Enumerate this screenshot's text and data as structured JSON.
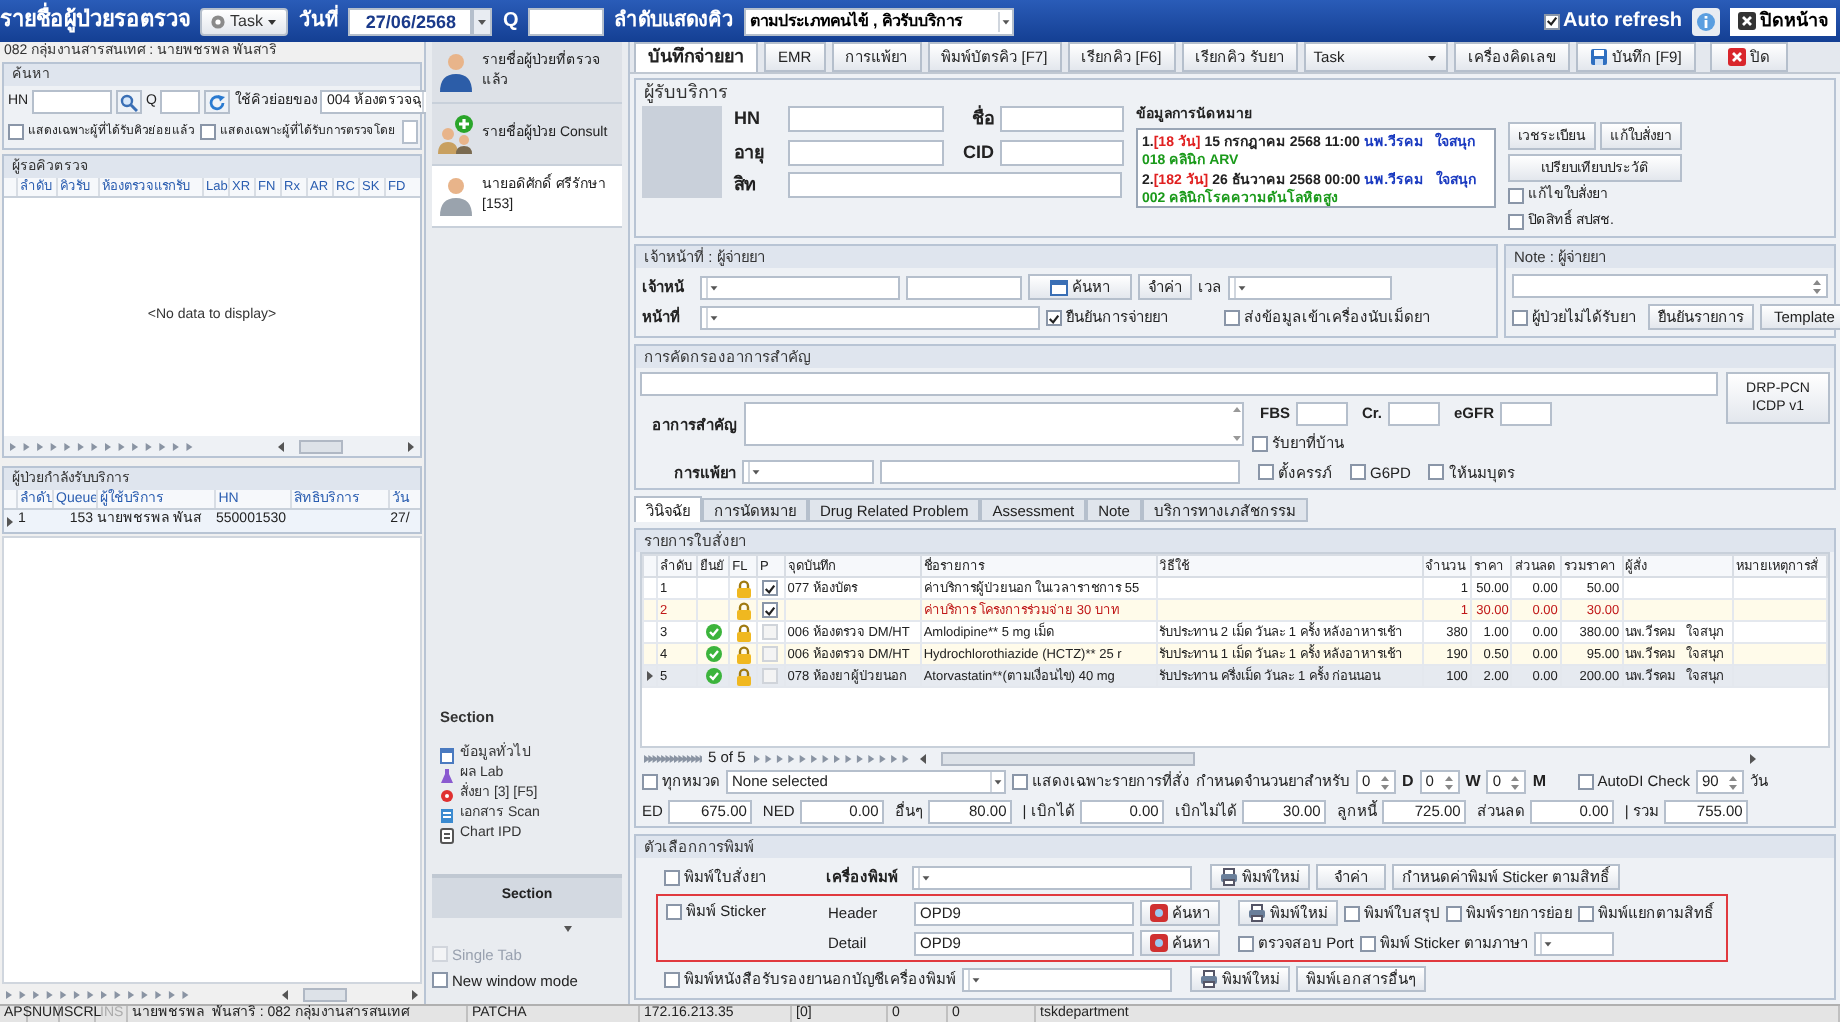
{
  "top_bar": {
    "title": "รายชื่อผู้ป่วยรอตรวจ",
    "task_button": "Task",
    "date_label": "วันที่",
    "date_value": "27/06/2568",
    "queue_label": "Q",
    "order_label": "ลำดับแสดงคิว",
    "order_value": "ตามประเภทคนไข้ , คิวรับบริการ",
    "auto_refresh": {
      "label": "Auto refresh",
      "checked": true
    },
    "close_button": "ปิดหน้าจ"
  },
  "left_panel": {
    "user_line": "082 กลุ่มงานสารสนเทศ : นายพชรพล  พันสาริ",
    "search": {
      "title": "ค้นหา",
      "hn_label": "HN",
      "q_label": "Q",
      "sub_queue_label": "ใช้คิวย่อยของ",
      "sub_queue_value": "004 ห้องตรวจฉุ",
      "options": [
        {
          "label": "แสดงเฉพาะผู้ที่ได้รับคิวย่อยแล้ว",
          "checked": false
        },
        {
          "label": "แสดงเฉพาะผู้ที่ได้รับการตรวจโดย",
          "checked": false
        }
      ]
    },
    "waiting": {
      "title": "ผู้รอคิวตรวจ",
      "columns": [
        "ลำดับ",
        "คิวรับ",
        "ห้องตรวจแรกรับ",
        "Lab",
        "XR",
        "FN",
        "Rx",
        "AR",
        "RC",
        "SK",
        "FD"
      ],
      "empty_text": "<No data to display>"
    },
    "in_service": {
      "title": "ผู้ป่วยกำลังรับบริการ",
      "columns": [
        "ลำดับ",
        "Queue",
        "ผู้ใช้บริการ",
        "HN",
        "สิทธิบริการ",
        "วัน"
      ],
      "rows": [
        {
          "selected": true,
          "order": "1",
          "queue": "153",
          "patient": "นายพชรพล  พันส",
          "hn": "550001530",
          "date": "27/"
        }
      ]
    }
  },
  "middle_panel": {
    "nav_items": [
      {
        "kind": "doctor",
        "label": "รายชื่อผู้ป่วยที่ตรวจแล้ว",
        "selected": false
      },
      {
        "kind": "consult",
        "label": "รายชื่อผู้ป่วย Consult",
        "selected": false
      },
      {
        "kind": "patient",
        "label": "นายอดิศักดิ์ ศรีรักษา [153]",
        "selected": true
      }
    ],
    "section_title": "Section",
    "section_items": [
      {
        "kind": "info",
        "label": "ข้อมูลทั่วไป"
      },
      {
        "kind": "lab",
        "label": "ผล Lab"
      },
      {
        "kind": "drug",
        "label": "สั่งยา [3] [F5]"
      },
      {
        "kind": "scan",
        "label": "เอกสาร Scan"
      },
      {
        "kind": "chart",
        "label": "Chart IPD"
      }
    ],
    "section_button": "Section",
    "window_options": [
      {
        "label": "Single Tab",
        "checked": false,
        "disabled": true
      },
      {
        "label": "New window mode",
        "checked": false,
        "disabled": false
      }
    ]
  },
  "toolbar": [
    {
      "kind": "tab",
      "label": "บันทึกจ่ายยา",
      "selected": true
    },
    {
      "kind": "tab",
      "label": "EMR",
      "selected": false
    },
    {
      "kind": "tab",
      "label": "การแพ้ยา",
      "selected": false
    },
    {
      "kind": "button",
      "label": "พิมพ์บัตรคิว [F7]",
      "selected": false
    },
    {
      "kind": "button",
      "label": "เรียกคิว [F6]",
      "selected": false
    },
    {
      "kind": "button",
      "label": "เรียกคิว รับยา",
      "selected": false
    },
    {
      "kind": "dropdown",
      "label": "Task",
      "selected": false
    },
    {
      "kind": "button",
      "label": "เครื่องคิดเลข",
      "selected": false
    },
    {
      "kind": "save",
      "label": "บันทึก [F9]",
      "selected": false
    },
    {
      "kind": "close",
      "label": "ปิด",
      "selected": false
    }
  ],
  "patient": {
    "title": "ผู้รับบริการ",
    "fields": [
      "HN",
      "ชื่อ",
      "อายุ",
      "CID",
      "สิท"
    ],
    "appointments": {
      "title": "ข้อมูลการนัดหมาย",
      "items": [
        {
          "number": "1.",
          "days": "[18 วัน]",
          "date": "15 กรกฎาคม 2568 11:00",
          "doctor": "นพ.วีรคม   ใจสนุก",
          "clinic": "018 คลินิก ARV"
        },
        {
          "number": "2.",
          "days": "[182 วัน]",
          "date": "26 ธันวาคม 2568 00:00",
          "doctor": "นพ.วีรคม   ใจสนุก",
          "clinic": "002 คลินิกโรคความดันโลหิตสูง"
        }
      ]
    },
    "buttons": [
      "เวชระเบียน",
      "แก้ใบสั่งยา",
      "เปรียบเทียบประวัติ"
    ],
    "options": [
      {
        "label": "แก้ไขใบสั่งยา",
        "checked": false
      },
      {
        "label": "ปิดสิทธิ์ สปสช.",
        "checked": false
      }
    ]
  },
  "dispenser": {
    "title": "เจ้าหน้าที่ : ผู้จ่ายยา",
    "officer_label": "เจ้าหน้",
    "search_button": "ค้นหา",
    "remember_button": "จำค่า",
    "time_label": "เวล",
    "role_label": "หน้าที่",
    "confirm": {
      "label": "ยืนยันการจ่ายยา",
      "checked": true
    },
    "send_counter": {
      "label": "ส่งข้อมูลเข้าเครื่องนับเม็ดยา",
      "checked": false
    }
  },
  "note": {
    "title": "Note : ผู้จ่ายยา",
    "no_drug": {
      "label": "ผู้ป่วยไม่ได้รับยา",
      "checked": false
    },
    "buttons": [
      "ยืนยันรายการ",
      "Template"
    ]
  },
  "screening": {
    "title": "การคัดกรองอาการสำคัญ",
    "symptom_label": "อาการสำคัญ",
    "allergy_label": "การแพ้ยา",
    "labs": [
      "FBS",
      "Cr.",
      "eGFR"
    ],
    "drp_button": [
      "DRP-PCN",
      "ICDP v1"
    ],
    "flags": [
      {
        "label": "รับยาที่บ้าน",
        "checked": false
      },
      {
        "label": "ตั้งครรภ์",
        "checked": false
      },
      {
        "label": "G6PD",
        "checked": false
      },
      {
        "label": "ให้นมบุตร",
        "checked": false
      }
    ]
  },
  "detail_tabs": [
    {
      "label": "วินิจฉัย",
      "selected": true
    },
    {
      "label": "การนัดหมาย",
      "selected": false
    },
    {
      "label": "Drug Related Problem",
      "selected": false
    },
    {
      "label": "Assessment",
      "selected": false
    },
    {
      "label": "Note",
      "selected": false
    },
    {
      "label": "บริการทางเภสัชกรรม",
      "selected": false
    }
  ],
  "orders": {
    "title": "รายการใบสั่งยา",
    "columns": [
      "ลำดับ",
      "ยืนยั",
      "FL",
      "P",
      "จุดบันทึก",
      "ชื่อรายการ",
      "วิธีใช้",
      "จำนวน",
      "ราคา",
      "ส่วนลด",
      "รวมราคา",
      "ผู้สั่ง",
      "หมายเหตุการสั่"
    ],
    "rows": [
      {
        "selected": false,
        "flagged": false,
        "no": "1",
        "confirmed": false,
        "locked": true,
        "printed": true,
        "station": "077 ห้องบัตร",
        "item": "ค่าบริการผู้ป่วยนอก ในเวลาราชการ 55",
        "quantity": "1",
        "price": "50.00",
        "discount": "0.00",
        "total": "50.00"
      },
      {
        "selected": false,
        "flagged": true,
        "no": "2",
        "confirmed": false,
        "locked": true,
        "printed": true,
        "item": "ค่าบริการ โครงการร่วมจ่าย 30 บาท",
        "quantity": "1",
        "price": "30.00",
        "discount": "0.00",
        "total": "30.00"
      },
      {
        "selected": false,
        "flagged": false,
        "no": "3",
        "confirmed": true,
        "locked": true,
        "printed": false,
        "station": "006 ห้องตรวจ DM/HT",
        "item": "Amlodipine** 5 mg เม็ด",
        "usage": "รับประทาน 2 เม็ด วันละ 1 ครั้ง หลังอาหารเช้า",
        "quantity": "380",
        "price": "1.00",
        "discount": "0.00",
        "total": "380.00",
        "prescriber": "นพ.วีรคม   ใจสนุก"
      },
      {
        "selected": false,
        "flagged": false,
        "no": "4",
        "confirmed": true,
        "locked": true,
        "printed": false,
        "station": "006 ห้องตรวจ DM/HT",
        "item": "Hydrochlorothiazide (HCTZ)** 25 r",
        "usage": "รับประทาน 1 เม็ด วันละ 1 ครั้ง หลังอาหารเช้า",
        "quantity": "190",
        "price": "0.50",
        "discount": "0.00",
        "total": "95.00",
        "prescriber": "นพ.วีรคม   ใจสนุก"
      },
      {
        "selected": true,
        "flagged": false,
        "no": "5",
        "confirmed": true,
        "locked": true,
        "printed": false,
        "station": "078 ห้องยาผู้ป่วยนอก",
        "item": "Atorvastatin**(ตามเงื่อนไข) 40 mg",
        "usage": "รับประทาน ครึ่งเม็ด วันละ 1 ครั้ง ก่อนนอน",
        "quantity": "100",
        "price": "2.00",
        "discount": "0.00",
        "total": "200.00",
        "prescriber": "นพ.วีรคม   ใจสนุก"
      }
    ],
    "pager": "5 of 5"
  },
  "filters": {
    "all_categories": {
      "label": "ทุกหมวด",
      "checked": false
    },
    "category_value": "None selected",
    "ordered_only": {
      "label": "แสดงเฉพาะรายการที่สั่ง",
      "checked": false
    },
    "supply_label": "กำหนดจำนวนยาสำหรับ",
    "units": [
      {
        "value": "0",
        "unit": "D"
      },
      {
        "value": "0",
        "unit": "W"
      },
      {
        "value": "0",
        "unit": "M"
      }
    ],
    "auto_di": {
      "label": "AutoDI Check",
      "checked": false
    },
    "days_value": "90",
    "days_label": "วัน"
  },
  "totals": [
    {
      "label": "ED",
      "value": "675.00"
    },
    {
      "label": "NED",
      "value": "0.00"
    },
    {
      "label": "อื่นๆ",
      "value": "80.00"
    },
    {
      "label": "| เบิกได้",
      "value": "0.00"
    },
    {
      "label": "เบิกไม่ได้",
      "value": "30.00"
    },
    {
      "label": "ลูกหนี้",
      "value": "725.00"
    },
    {
      "label": "ส่วนลด",
      "value": "0.00"
    },
    {
      "label": "| รวม",
      "value": "755.00"
    }
  ],
  "print_options": {
    "title": "ตัวเลือกการพิมพ์",
    "print_rx": {
      "label": "พิมพ์ใบสั่งยา",
      "checked": false
    },
    "printer_label": "เครื่องพิมพ์",
    "reprint_button": "พิมพ์ใหม่",
    "remember_button": "จำค่า",
    "sticker_rights_button": "กำหนดค่าพิมพ์ Sticker ตามสิทธิ์",
    "sticker": {
      "label": "พิมพ์ Sticker",
      "checked": false,
      "header_label": "Header",
      "header_value": "OPD9",
      "header_search_button": "ค้นหา",
      "reprint_button": "พิมพ์ใหม่",
      "options": [
        {
          "label": "พิมพ์ใบสรุป",
          "checked": false
        },
        {
          "label": "พิมพ์รายการย่อย",
          "checked": false
        },
        {
          "label": "พิมพ์แยกตามสิทธิ์",
          "checked": false
        }
      ],
      "detail_label": "Detail",
      "detail_value": "OPD9",
      "detail_search_button": "ค้นหา",
      "detail_options": [
        {
          "label": "ตรวจสอบ Port",
          "checked": false
        },
        {
          "label": "พิมพ์ Sticker ตามภาษา",
          "checked": false
        }
      ]
    },
    "certificate": {
      "label": "พิมพ์หนังสือรับรองยานอกบัญชีเครื่องพิมพ์",
      "checked": false
    },
    "certificate_reprint_button": "พิมพ์ใหม่",
    "other_docs_button": "พิมพ์เอกสารอื่นๆ"
  },
  "status_bar": [
    {
      "text": "APS",
      "enabled": true
    },
    {
      "text": "NUM",
      "enabled": true
    },
    {
      "text": "SCRL",
      "enabled": true
    },
    {
      "text": "INS",
      "enabled": false
    },
    {
      "text": "นายพชรพล  พันสาริ : 082 กลุ่มงานสารสนเทศ",
      "enabled": true
    },
    {
      "text": "PATCHA",
      "enabled": true
    },
    {
      "text": "172.16.213.35",
      "enabled": true
    },
    {
      "text": "[0]",
      "enabled": true
    },
    {
      "text": "0",
      "enabled": true
    },
    {
      "text": "0",
      "enabled": true
    },
    {
      "text": "tskdepartment",
      "enabled": true
    }
  ]
}
